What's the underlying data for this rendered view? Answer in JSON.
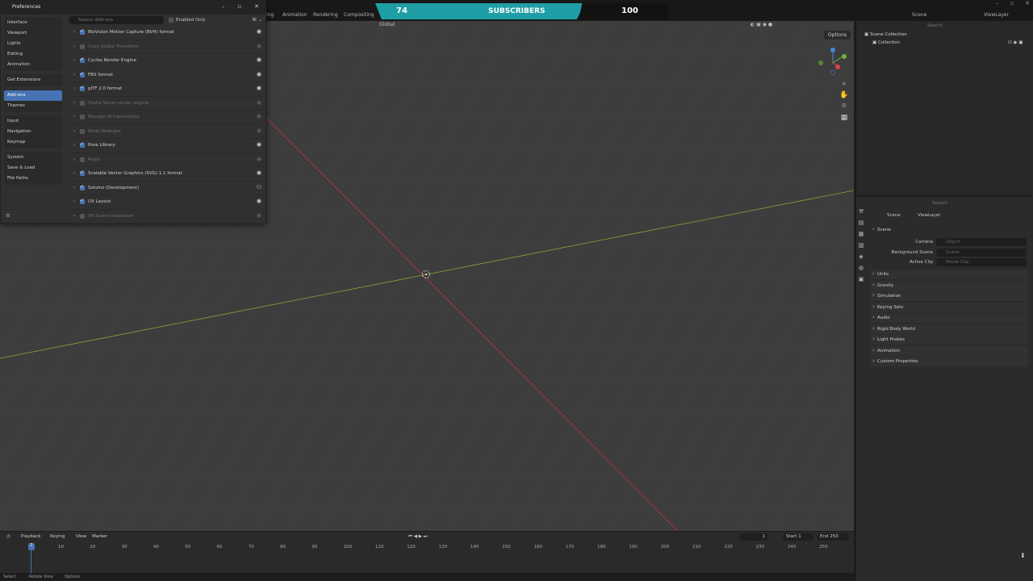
{
  "topbar": {
    "tabs": [
      "ing",
      "Animation",
      "Rendering",
      "Compositing"
    ],
    "scene_label": "Scene",
    "viewlayer_label": "ViewLayer"
  },
  "banner": {
    "current": "74",
    "label": "SUBSCRIBERS",
    "goal": "100",
    "progress": 0.74,
    "colors": {
      "fill": "#1f9fa5",
      "track": "#121212"
    }
  },
  "viewport": {
    "orientation": "Global",
    "options_label": "Options",
    "colors": {
      "x_axis": "#c0393b",
      "y_axis": "#8ca33a",
      "background": "#3d3d3d"
    }
  },
  "preferences": {
    "title": "Preferences",
    "sidebar_groups": [
      [
        "Interface",
        "Viewport",
        "Lights",
        "Editing",
        "Animation"
      ],
      [
        "Get Extensions"
      ],
      [
        "Add-ons",
        "Themes"
      ],
      [
        "Input",
        "Navigation",
        "Keymap"
      ],
      [
        "System",
        "Save & Load",
        "File Paths"
      ]
    ],
    "active_item": "Add-ons",
    "search_placeholder": "Search Add-ons",
    "enabled_only_label": "Enabled Only",
    "addons": [
      {
        "name": "BioVision Motion Capture (BVH) format",
        "enabled": true,
        "icon": "blender-icon"
      },
      {
        "name": "Copy Global Transform",
        "enabled": false,
        "icon": "blender-icon"
      },
      {
        "name": "Cycles Render Engine",
        "enabled": true,
        "icon": "blender-icon"
      },
      {
        "name": "FBX format",
        "enabled": true,
        "icon": "blender-icon"
      },
      {
        "name": "glTF 2.0 format",
        "enabled": true,
        "icon": "blender-icon"
      },
      {
        "name": "Hydra Storm render engine",
        "enabled": false,
        "icon": "blender-icon"
      },
      {
        "name": "Manage UI translations",
        "enabled": false,
        "icon": "blender-icon"
      },
      {
        "name": "Node Wrangler",
        "enabled": false,
        "icon": "blender-icon"
      },
      {
        "name": "Pose Library",
        "enabled": true,
        "icon": "blender-icon"
      },
      {
        "name": "Rigify",
        "enabled": false,
        "icon": "blender-icon"
      },
      {
        "name": "Scalable Vector Graphics (SVG) 1.1 format",
        "enabled": true,
        "icon": "blender-icon"
      },
      {
        "name": "Solumz (Development)",
        "enabled": true,
        "icon": "user-icon"
      },
      {
        "name": "UV Layout",
        "enabled": true,
        "icon": "blender-icon"
      },
      {
        "name": "VR Scene Inspection",
        "enabled": false,
        "icon": "blender-icon"
      }
    ]
  },
  "outliner": {
    "search_placeholder": "Search",
    "scene_collection": "Scene Collection",
    "collection": "Collection"
  },
  "properties": {
    "search_placeholder": "Search",
    "breadcrumb_scene": "Scene",
    "breadcrumb_viewlayer": "ViewLayer",
    "section_title": "Scene",
    "fields": [
      {
        "label": "Camera",
        "placeholder": "Object"
      },
      {
        "label": "Background Scene",
        "placeholder": "Scene"
      },
      {
        "label": "Active Clip",
        "placeholder": "Movie Clip"
      }
    ],
    "panels": [
      "Units",
      "Gravity",
      "Simulation",
      "Keying Sets",
      "Audio",
      "Rigid Body World",
      "Light Probes",
      "Animation",
      "Custom Properties"
    ]
  },
  "timeline": {
    "menus": [
      "Playback",
      "Keying",
      "View",
      "Marker"
    ],
    "current_frame": "1",
    "start_label": "Start",
    "start": "1",
    "end_label": "End",
    "end": "250",
    "ticks": [
      "10",
      "20",
      "30",
      "40",
      "50",
      "60",
      "70",
      "80",
      "90",
      "100",
      "110",
      "120",
      "130",
      "140",
      "150",
      "160",
      "170",
      "180",
      "190",
      "200",
      "210",
      "220",
      "230",
      "240",
      "250"
    ]
  },
  "statusbar": {
    "items": [
      "Select",
      "Rotate View",
      "Options"
    ]
  }
}
